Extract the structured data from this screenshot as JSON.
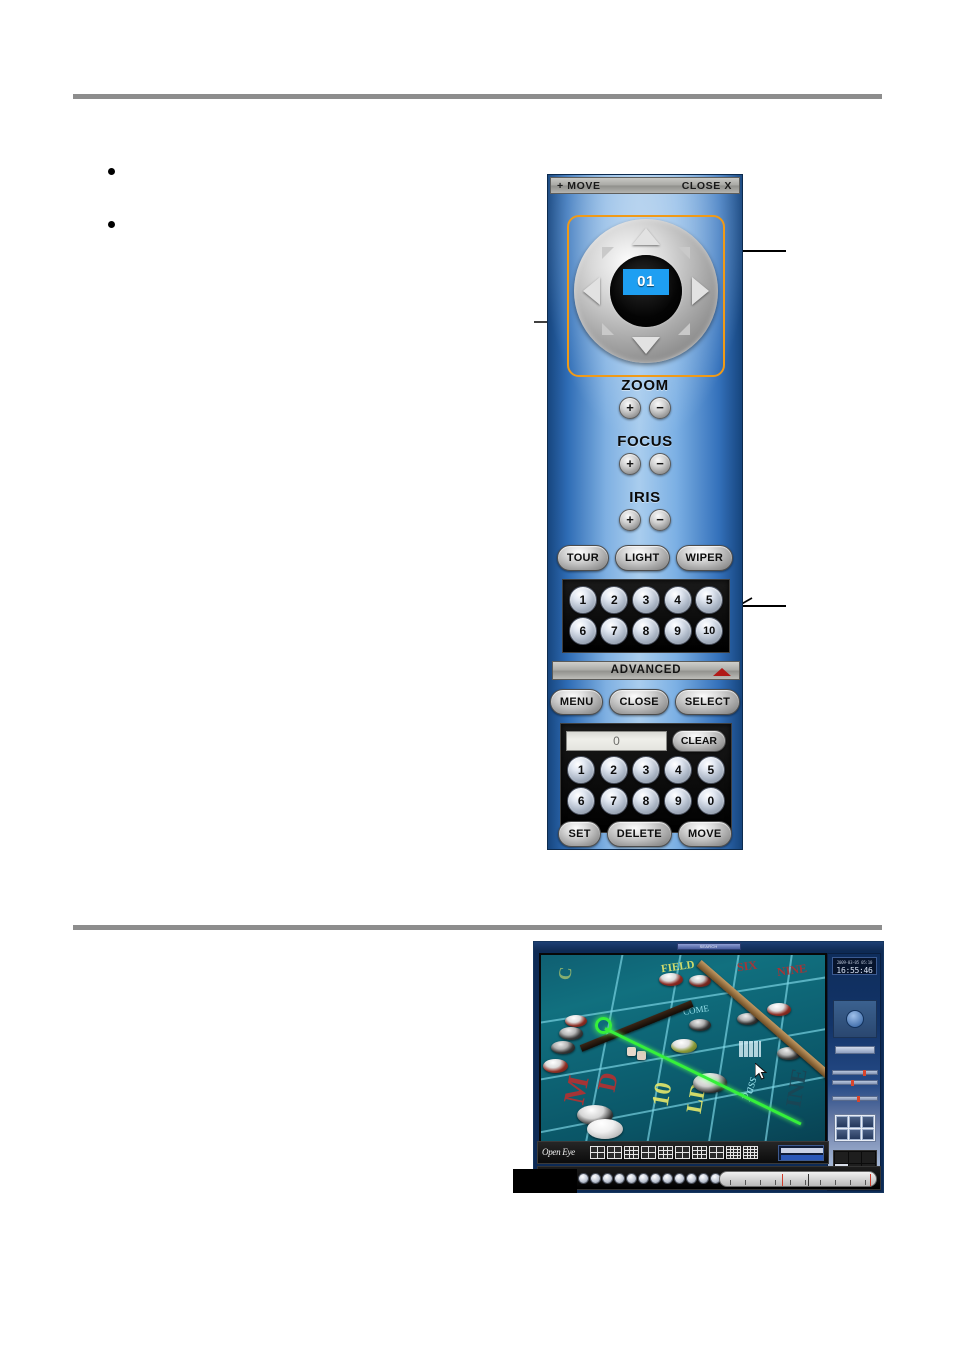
{
  "document": {
    "bullets": [
      "",
      ""
    ]
  },
  "ptz_panel": {
    "titlebar": {
      "left_label": "+  MOVE",
      "right_label": "CLOSE  X"
    },
    "dpad": {
      "camera_readout": "01",
      "arrows": [
        "up",
        "down",
        "left",
        "right",
        "up-left",
        "up-right",
        "down-left",
        "down-right"
      ]
    },
    "lens_controls": [
      {
        "label": "ZOOM",
        "plus": "+",
        "minus": "−"
      },
      {
        "label": "FOCUS",
        "plus": "+",
        "minus": "−"
      },
      {
        "label": "IRIS",
        "plus": "+",
        "minus": "−"
      }
    ],
    "function_buttons": [
      "TOUR",
      "LIGHT",
      "WIPER"
    ],
    "preset_buttons": [
      "1",
      "2",
      "3",
      "4",
      "5",
      "6",
      "7",
      "8",
      "9",
      "10"
    ],
    "advanced": {
      "title": "ADVANCED",
      "collapse_icon": "triangle-up-icon",
      "top_buttons": [
        "MENU",
        "CLOSE",
        "SELECT"
      ],
      "display_value": "0",
      "clear_label": "CLEAR",
      "keypad": [
        "1",
        "2",
        "3",
        "4",
        "5",
        "6",
        "7",
        "8",
        "9",
        "0"
      ],
      "bottom_buttons": [
        "SET",
        "DELETE",
        "MOVE"
      ]
    },
    "highlight_color": "#f09a17",
    "readout_color": "#1e9ff2"
  },
  "dvr_screenshot": {
    "title_chip": "SEARCH",
    "clock": {
      "date_line": "2009-03-05 05:10",
      "time_line": "16:55:46"
    },
    "logo": "Open Eye",
    "laser_overlay": true,
    "felt_labels": [
      "COME",
      "FIELD",
      "10",
      "Pass Line",
      "LINE"
    ],
    "camera_dot_count": 16
  }
}
